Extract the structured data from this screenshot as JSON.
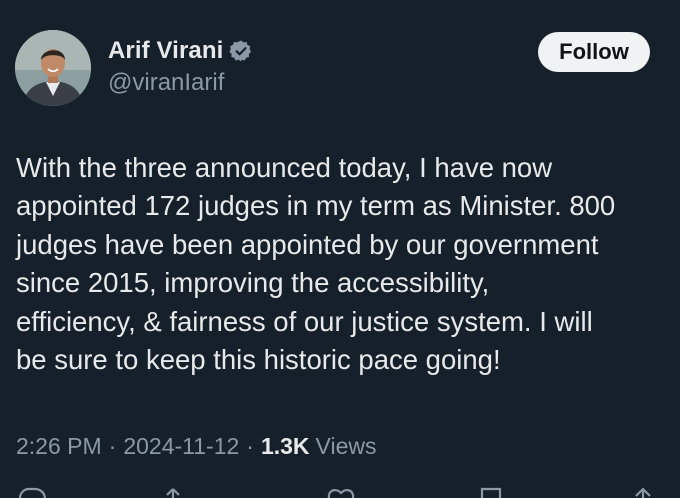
{
  "author": {
    "display_name": "Arif Virani",
    "handle": "@viranIarif",
    "verified": true
  },
  "follow_button": {
    "label": "Follow"
  },
  "tweet": {
    "text": "With the three announced today, I have now\nappointed 172 judges in my term as Minister. 800\njudges have been appointed by our government\nsince 2015,  improving the accessibility,\nefficiency, & fairness of our justice system. I will\nbe sure to keep this historic pace going!"
  },
  "meta": {
    "time": "2:26 PM",
    "separator": "·",
    "date": "2024-11-12",
    "views_count": "1.3K",
    "views_label": "Views"
  },
  "actions": [
    {
      "name": "reply-icon"
    },
    {
      "name": "retweet-icon"
    },
    {
      "name": "like-icon"
    },
    {
      "name": "bookmark-icon"
    },
    {
      "name": "share-icon"
    }
  ],
  "colors": {
    "background": "#15202b",
    "text_primary": "#e7e9ea",
    "text_secondary": "#8b98a5",
    "verified_badge": "#8b98a5",
    "follow_button_bg": "#eff3f4"
  }
}
